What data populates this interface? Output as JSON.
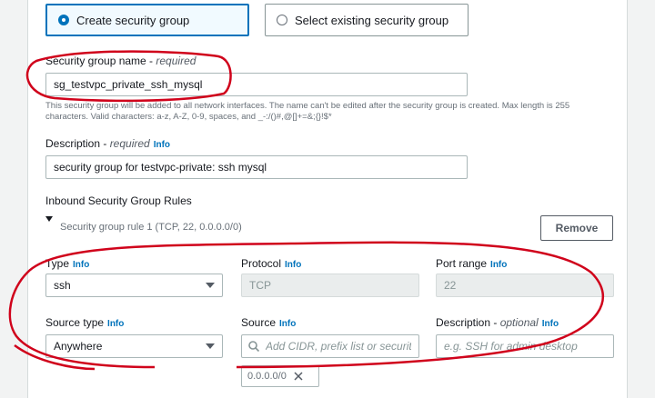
{
  "group_choice": {
    "create_label": "Create security group",
    "select_label": "Select existing security group"
  },
  "sg_name": {
    "label": "Security group name - ",
    "required": "required",
    "value": "sg_testvpc_private_ssh_mysql",
    "help": "This security group will be added to all network interfaces. The name can't be edited after the security group is created. Max length is 255 characters. Valid characters: a-z, A-Z, 0-9, spaces, and _-:/()#,@[]+=&;{}!$*"
  },
  "description": {
    "label": "Description - ",
    "required": "required",
    "info": "Info",
    "value": "security group for testvpc-private: ssh mysql"
  },
  "rules": {
    "section_title": "Inbound Security Group Rules",
    "rule_title": "Security group rule 1 (TCP, 22, 0.0.0.0/0)",
    "remove_label": "Remove",
    "type": {
      "label": "Type",
      "info": "Info",
      "value": "ssh"
    },
    "protocol": {
      "label": "Protocol",
      "info": "Info",
      "value": "TCP"
    },
    "port_range": {
      "label": "Port range",
      "info": "Info",
      "value": "22"
    },
    "source_type": {
      "label": "Source type",
      "info": "Info",
      "value": "Anywhere"
    },
    "source": {
      "label": "Source",
      "info": "Info",
      "placeholder": "Add CIDR, prefix list or security",
      "token": "0.0.0.0/0"
    },
    "rule_description": {
      "label": "Description - ",
      "optional": "optional",
      "info": "Info",
      "placeholder": "e.g. SSH for admin desktop"
    }
  },
  "colors": {
    "accent": "#0073bb",
    "annotation": "#d0021b"
  }
}
